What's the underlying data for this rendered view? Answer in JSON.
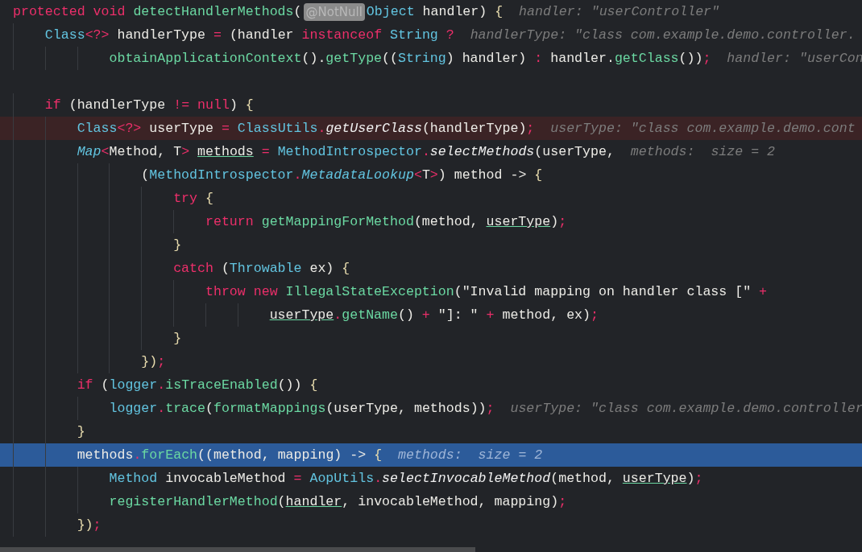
{
  "editor": {
    "lines": [
      {
        "kind": "code",
        "segments": [
          {
            "kind": "code",
            "tokens": [
              {
                "text": "protected void ",
                "kind": "keyword"
              },
              {
                "text": "detectHandlerMethods",
                "kind": "method"
              },
              {
                "text": "(",
                "kind": "plain"
              }
            ]
          },
          {
            "kind": "badge",
            "text": "@NotNull"
          },
          {
            "kind": "code",
            "tokens": [
              {
                "text": "Object",
                "kind": "class"
              },
              {
                "text": " handler) ",
                "kind": "plain"
              },
              {
                "text": "{",
                "kind": "brace"
              }
            ]
          }
        ],
        "hint": "handler: \"userController\""
      },
      {
        "kind": "code",
        "segments": [
          {
            "kind": "code",
            "tokens": [
              {
                "text": "    Class",
                "kind": "class"
              },
              {
                "text": "<?>",
                "kind": "operator"
              },
              {
                "text": " handlerType ",
                "kind": "plain"
              },
              {
                "text": "=",
                "kind": "operator"
              },
              {
                "text": " (handler ",
                "kind": "plain"
              },
              {
                "text": "instanceof ",
                "kind": "keyword"
              },
              {
                "text": "String ",
                "kind": "class"
              },
              {
                "text": "?",
                "kind": "operator"
              }
            ]
          }
        ],
        "hint": "handlerType: \"class com.example.demo.controller."
      },
      {
        "kind": "code",
        "segments": [
          {
            "kind": "code",
            "tokens": [
              {
                "text": "            obtainApplicationContext",
                "kind": "method"
              },
              {
                "text": "().",
                "kind": "plain"
              },
              {
                "text": "getType",
                "kind": "method"
              },
              {
                "text": "((",
                "kind": "plain"
              },
              {
                "text": "String",
                "kind": "class"
              },
              {
                "text": ") handler) ",
                "kind": "plain"
              },
              {
                "text": ":",
                "kind": "operator"
              },
              {
                "text": " handler.",
                "kind": "plain"
              },
              {
                "text": "getClass",
                "kind": "method"
              },
              {
                "text": "())",
                "kind": "plain"
              },
              {
                "text": ";",
                "kind": "operator"
              }
            ]
          }
        ],
        "hint": "handler: \"userCon"
      },
      {
        "kind": "blank"
      },
      {
        "kind": "code",
        "segments": [
          {
            "kind": "code",
            "tokens": [
              {
                "text": "    if",
                "kind": "keyword"
              },
              {
                "text": " (handlerType ",
                "kind": "plain"
              },
              {
                "text": "!= null",
                "kind": "keyword"
              },
              {
                "text": ") ",
                "kind": "plain"
              },
              {
                "text": "{",
                "kind": "brace"
              }
            ]
          }
        ]
      },
      {
        "kind": "breakpoint",
        "segments": [
          {
            "kind": "code",
            "tokens": [
              {
                "text": "        Class",
                "kind": "class"
              },
              {
                "text": "<?>",
                "kind": "operator"
              },
              {
                "text": " userType ",
                "kind": "plain"
              },
              {
                "text": "=",
                "kind": "operator"
              },
              {
                "text": " ClassUtils",
                "kind": "class"
              },
              {
                "text": ".",
                "kind": "operator"
              },
              {
                "text": "getUserClass",
                "kind": "italicmethod"
              },
              {
                "text": "(handlerType)",
                "kind": "plain"
              },
              {
                "text": ";",
                "kind": "operator"
              }
            ]
          }
        ],
        "hint": "userType: \"class com.example.demo.cont"
      },
      {
        "kind": "code",
        "segments": [
          {
            "kind": "code",
            "tokens": [
              {
                "text": "        Map",
                "kind": "italicclass"
              },
              {
                "text": "<",
                "kind": "operator"
              },
              {
                "text": "Method, T",
                "kind": "plain"
              },
              {
                "text": "> ",
                "kind": "operator"
              },
              {
                "text": "methods",
                "kind": "underlined"
              },
              {
                "text": " =",
                "kind": "operator"
              },
              {
                "text": " MethodIntrospector",
                "kind": "class"
              },
              {
                "text": ".",
                "kind": "operator"
              },
              {
                "text": "selectMethods",
                "kind": "italicmethod"
              },
              {
                "text": "(userType,",
                "kind": "plain"
              }
            ]
          }
        ],
        "hint": "methods:  size = 2"
      },
      {
        "kind": "code",
        "segments": [
          {
            "kind": "code",
            "tokens": [
              {
                "text": "                (",
                "kind": "plain"
              },
              {
                "text": "MethodIntrospector",
                "kind": "class"
              },
              {
                "text": ".",
                "kind": "operator"
              },
              {
                "text": "MetadataLookup",
                "kind": "italicclass"
              },
              {
                "text": "<",
                "kind": "operator"
              },
              {
                "text": "T",
                "kind": "plain"
              },
              {
                "text": ">",
                "kind": "operator"
              },
              {
                "text": ") method -> ",
                "kind": "plain"
              },
              {
                "text": "{",
                "kind": "brace"
              }
            ]
          }
        ]
      },
      {
        "kind": "code",
        "segments": [
          {
            "kind": "code",
            "tokens": [
              {
                "text": "                    try ",
                "kind": "keyword"
              },
              {
                "text": "{",
                "kind": "brace"
              }
            ]
          }
        ]
      },
      {
        "kind": "code",
        "segments": [
          {
            "kind": "code",
            "tokens": [
              {
                "text": "                        return ",
                "kind": "keyword"
              },
              {
                "text": "getMappingForMethod",
                "kind": "method"
              },
              {
                "text": "(method, ",
                "kind": "plain"
              },
              {
                "text": "userType",
                "kind": "underlined"
              },
              {
                "text": ")",
                "kind": "plain"
              },
              {
                "text": ";",
                "kind": "operator"
              }
            ]
          }
        ]
      },
      {
        "kind": "code",
        "segments": [
          {
            "kind": "code",
            "tokens": [
              {
                "text": "                    }",
                "kind": "brace"
              }
            ]
          }
        ]
      },
      {
        "kind": "code",
        "segments": [
          {
            "kind": "code",
            "tokens": [
              {
                "text": "                    catch",
                "kind": "keyword"
              },
              {
                "text": " (",
                "kind": "plain"
              },
              {
                "text": "Throwable",
                "kind": "class"
              },
              {
                "text": " ex) ",
                "kind": "plain"
              },
              {
                "text": "{",
                "kind": "brace"
              }
            ]
          }
        ]
      },
      {
        "kind": "code",
        "segments": [
          {
            "kind": "code",
            "tokens": [
              {
                "text": "                        throw new ",
                "kind": "keyword"
              },
              {
                "text": "IllegalStateException",
                "kind": "method"
              },
              {
                "text": "(\"Invalid mapping on handler class [\" ",
                "kind": "plain"
              },
              {
                "text": "+",
                "kind": "operator"
              }
            ]
          }
        ]
      },
      {
        "kind": "code",
        "segments": [
          {
            "kind": "code",
            "tokens": [
              {
                "text": "                                userType",
                "kind": "underlined"
              },
              {
                "text": ".",
                "kind": "operator"
              },
              {
                "text": "getName",
                "kind": "method"
              },
              {
                "text": "() ",
                "kind": "plain"
              },
              {
                "text": "+",
                "kind": "operator"
              },
              {
                "text": " \"]: \" ",
                "kind": "plain"
              },
              {
                "text": "+",
                "kind": "operator"
              },
              {
                "text": " method, ex)",
                "kind": "plain"
              },
              {
                "text": ";",
                "kind": "operator"
              }
            ]
          }
        ]
      },
      {
        "kind": "code",
        "segments": [
          {
            "kind": "code",
            "tokens": [
              {
                "text": "                    }",
                "kind": "brace"
              }
            ]
          }
        ]
      },
      {
        "kind": "code",
        "segments": [
          {
            "kind": "code",
            "tokens": [
              {
                "text": "                })",
                "kind": "brace"
              },
              {
                "text": ";",
                "kind": "operator"
              }
            ]
          }
        ]
      },
      {
        "kind": "code",
        "segments": [
          {
            "kind": "code",
            "tokens": [
              {
                "text": "        if",
                "kind": "keyword"
              },
              {
                "text": " (",
                "kind": "plain"
              },
              {
                "text": "logger",
                "kind": "class"
              },
              {
                "text": ".",
                "kind": "operator"
              },
              {
                "text": "isTraceEnabled",
                "kind": "method"
              },
              {
                "text": "()) ",
                "kind": "plain"
              },
              {
                "text": "{",
                "kind": "brace"
              }
            ]
          }
        ]
      },
      {
        "kind": "code",
        "segments": [
          {
            "kind": "code",
            "tokens": [
              {
                "text": "            logger",
                "kind": "class"
              },
              {
                "text": ".",
                "kind": "operator"
              },
              {
                "text": "trace",
                "kind": "method"
              },
              {
                "text": "(",
                "kind": "plain"
              },
              {
                "text": "formatMappings",
                "kind": "method"
              },
              {
                "text": "(userType, methods))",
                "kind": "plain"
              },
              {
                "text": ";",
                "kind": "operator"
              }
            ]
          }
        ],
        "hint": "userType: \"class com.example.demo.controller"
      },
      {
        "kind": "code",
        "segments": [
          {
            "kind": "code",
            "tokens": [
              {
                "text": "        }",
                "kind": "brace"
              }
            ]
          }
        ]
      },
      {
        "kind": "execution",
        "segments": [
          {
            "kind": "code",
            "tokens": [
              {
                "text": "        methods",
                "kind": "plain"
              },
              {
                "text": ".",
                "kind": "operator"
              },
              {
                "text": "forEach",
                "kind": "method"
              },
              {
                "text": "((method, mapping) -> ",
                "kind": "plain"
              },
              {
                "text": "{",
                "kind": "brace"
              }
            ]
          }
        ],
        "hint": "methods:  size = 2"
      },
      {
        "kind": "code",
        "segments": [
          {
            "kind": "code",
            "tokens": [
              {
                "text": "            Method",
                "kind": "class"
              },
              {
                "text": " invocableMethod ",
                "kind": "plain"
              },
              {
                "text": "=",
                "kind": "operator"
              },
              {
                "text": " AopUtils",
                "kind": "class"
              },
              {
                "text": ".",
                "kind": "operator"
              },
              {
                "text": "selectInvocableMethod",
                "kind": "italicmethod"
              },
              {
                "text": "(method, ",
                "kind": "plain"
              },
              {
                "text": "userType",
                "kind": "underlined"
              },
              {
                "text": ")",
                "kind": "plain"
              },
              {
                "text": ";",
                "kind": "operator"
              }
            ]
          }
        ]
      },
      {
        "kind": "code",
        "segments": [
          {
            "kind": "code",
            "tokens": [
              {
                "text": "            registerHandlerMethod",
                "kind": "method"
              },
              {
                "text": "(",
                "kind": "plain"
              },
              {
                "text": "handler",
                "kind": "underlined"
              },
              {
                "text": ", invocableMethod, mapping)",
                "kind": "plain"
              },
              {
                "text": ";",
                "kind": "operator"
              }
            ]
          }
        ]
      },
      {
        "kind": "code",
        "segments": [
          {
            "kind": "code",
            "tokens": [
              {
                "text": "        })",
                "kind": "brace"
              },
              {
                "text": ";",
                "kind": "operator"
              }
            ]
          }
        ]
      }
    ]
  }
}
